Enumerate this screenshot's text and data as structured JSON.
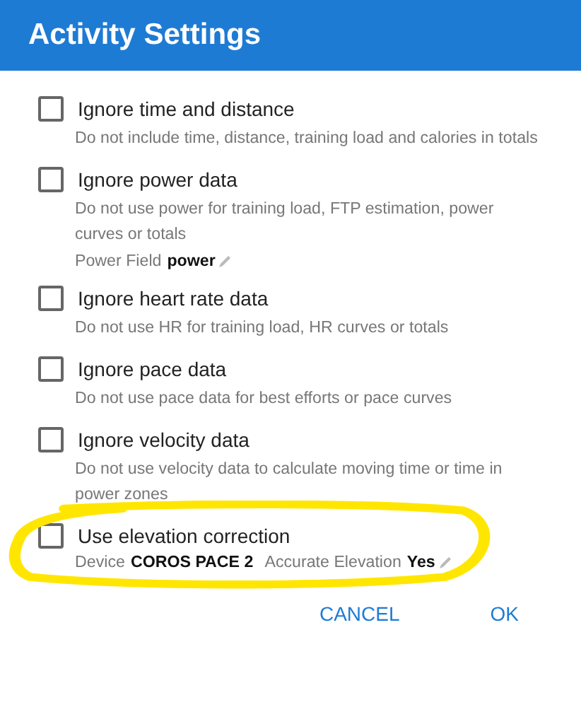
{
  "dialog": {
    "title": "Activity Settings"
  },
  "options": [
    {
      "label": "Ignore time and distance",
      "checked": false,
      "description": "Do not include time, distance, training load and calories in totals"
    },
    {
      "label": "Ignore power data",
      "checked": false,
      "description": "Do not use power for training load, FTP estimation, power curves or totals",
      "fields": [
        {
          "label": "Power Field",
          "value": "power",
          "editable": true
        }
      ]
    },
    {
      "label": "Ignore heart rate data",
      "checked": false,
      "description": "Do not use HR for training load, HR curves or totals"
    },
    {
      "label": "Ignore pace data",
      "checked": false,
      "description": "Do not use pace data for best efforts or pace curves"
    },
    {
      "label": "Ignore velocity data",
      "checked": false,
      "description": "Do not use velocity data to calculate moving time or time in power zones"
    },
    {
      "label": "Use elevation correction",
      "checked": false,
      "highlighted": true,
      "fields": [
        {
          "label": "Device",
          "value": "COROS PACE 2",
          "editable": false
        },
        {
          "label": "Accurate Elevation",
          "value": "Yes",
          "editable": true
        }
      ]
    }
  ],
  "buttons": [
    "CANCEL",
    "OK"
  ]
}
